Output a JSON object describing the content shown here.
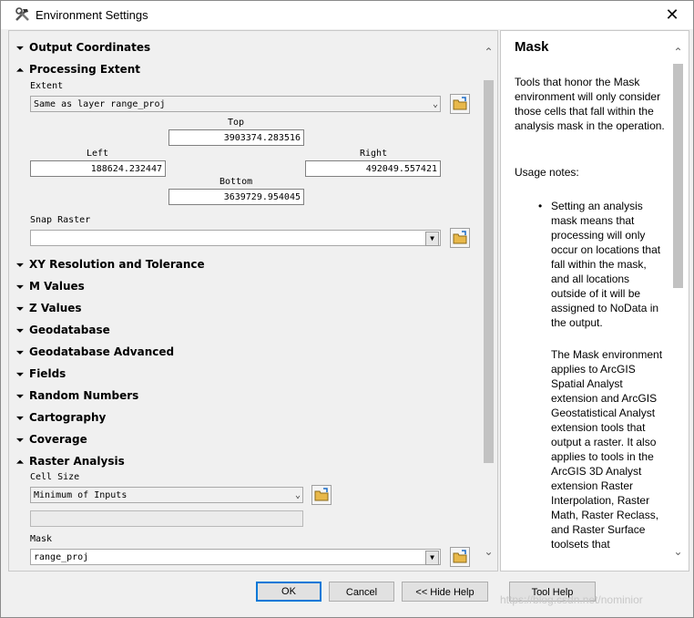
{
  "window": {
    "title": "Environment Settings",
    "close_glyph": "✕"
  },
  "sections": [
    {
      "label": "Output Coordinates",
      "state": "collapsed"
    },
    {
      "label": "Processing Extent",
      "state": "expanded"
    },
    {
      "label": "XY Resolution and Tolerance",
      "state": "collapsed"
    },
    {
      "label": "M Values",
      "state": "collapsed"
    },
    {
      "label": "Z Values",
      "state": "collapsed"
    },
    {
      "label": "Geodatabase",
      "state": "collapsed"
    },
    {
      "label": "Geodatabase Advanced",
      "state": "collapsed"
    },
    {
      "label": "Fields",
      "state": "collapsed"
    },
    {
      "label": "Random Numbers",
      "state": "collapsed"
    },
    {
      "label": "Cartography",
      "state": "collapsed"
    },
    {
      "label": "Coverage",
      "state": "collapsed"
    },
    {
      "label": "Raster Analysis",
      "state": "expanded"
    }
  ],
  "extent": {
    "label": "Extent",
    "value": "Same as layer range_proj",
    "top_label": "Top",
    "top": "3903374.283516",
    "left_label": "Left",
    "left": "188624.232447",
    "right_label": "Right",
    "right": "492049.557421",
    "bottom_label": "Bottom",
    "bottom": "3639729.954045"
  },
  "snap_raster": {
    "label": "Snap Raster",
    "value": ""
  },
  "raster_analysis": {
    "cell_size_label": "Cell Size",
    "cell_size": "Minimum of Inputs",
    "mask_label": "Mask",
    "mask": "range_proj"
  },
  "help": {
    "title": "Mask",
    "intro": "Tools that honor the Mask environment will only consider those cells that fall within the analysis mask in the operation.",
    "usage": "Usage notes:",
    "bullet": "Setting an analysis mask means that processing will only occur on locations that fall within the mask, and all locations outside of it will be assigned to NoData in the output.",
    "para2": "The Mask environment applies to ArcGIS Spatial Analyst extension and ArcGIS Geostatistical Analyst extension tools that output a raster. It also applies to tools in the ArcGIS 3D Analyst extension Raster Interpolation, Raster Math, Raster Reclass, and Raster Surface toolsets that"
  },
  "buttons": {
    "ok": "OK",
    "cancel": "Cancel",
    "hide_help": "<< Hide Help",
    "tool_help": "Tool Help"
  },
  "watermark": "https://blog.csdn.net/nominior",
  "icons": [
    "hammer-wrench-icon",
    "close-icon",
    "expand-chevron-icon",
    "collapse-chevron-icon",
    "folder-icon",
    "dropdown-arrow-icon",
    "scroll-up-icon",
    "scroll-down-icon"
  ]
}
